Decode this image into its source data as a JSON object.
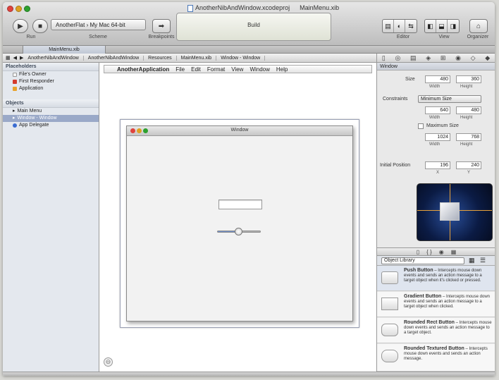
{
  "toolbar": {
    "run_label": "Run",
    "stop_label": "Stop",
    "breakpoints_label": "Breakpoints",
    "scheme_label": "Scheme",
    "scheme_value": "AnotherFlat › My Mac 64-bit",
    "activity_status": "Build",
    "window_title_doc1": "AnotherNibAndWindow.xcodeproj",
    "window_title_doc2": "MainMenu.xib",
    "editor_label": "Editor",
    "view_label": "View",
    "organizer_label": "Organizer"
  },
  "tabs": {
    "active_tab": "MainMenu.xib"
  },
  "jumpbar": {
    "crumbs": [
      "AnotherNibAndWindow",
      "AnotherNibAndWindow",
      "Resources",
      "MainMenu.xib",
      "Window - Window"
    ]
  },
  "navigator": {
    "placeholders_header": "Placeholders",
    "placeholders": [
      "File's Owner",
      "First Responder",
      "Application"
    ],
    "objects_header": "Objects",
    "objects": [
      "Main Menu",
      "Window - Window",
      "App Delegate"
    ]
  },
  "canvas": {
    "menu_items": [
      "AnotherApplication",
      "File",
      "Edit",
      "Format",
      "View",
      "Window",
      "Help"
    ],
    "window_title": "Window",
    "slider_value": 0.5
  },
  "inspector": {
    "section": "Window",
    "size_label": "Size",
    "width_value": "480",
    "height_value": "360",
    "constraints_label": "Constraints",
    "constraints_value": "Minimum Size",
    "min_width": "640",
    "min_height": "480",
    "max_size_label": "Maximum Size",
    "max_width": "1024",
    "max_height": "768",
    "position_label": "Initial Position",
    "pos_x": "196",
    "pos_y": "240",
    "width_sub": "Width",
    "height_sub": "Height",
    "x_sub": "X",
    "y_sub": "Y"
  },
  "library": {
    "filter_value": "Object Library",
    "items": [
      {
        "title": "Push Button",
        "desc": "Intercepts mouse down events and sends an action message to a target object when it's clicked or pressed."
      },
      {
        "title": "Gradient Button",
        "desc": "Intercepts mouse down events and sends an action message to a target object when clicked."
      },
      {
        "title": "Rounded Rect Button",
        "desc": "Intercepts mouse down events and sends an action message to a target object."
      },
      {
        "title": "Rounded Textured Button",
        "desc": "Intercepts mouse down events and sends an action message."
      }
    ]
  },
  "colors": {
    "selection": "#9aa9c8",
    "accent": "#4a78b8"
  }
}
